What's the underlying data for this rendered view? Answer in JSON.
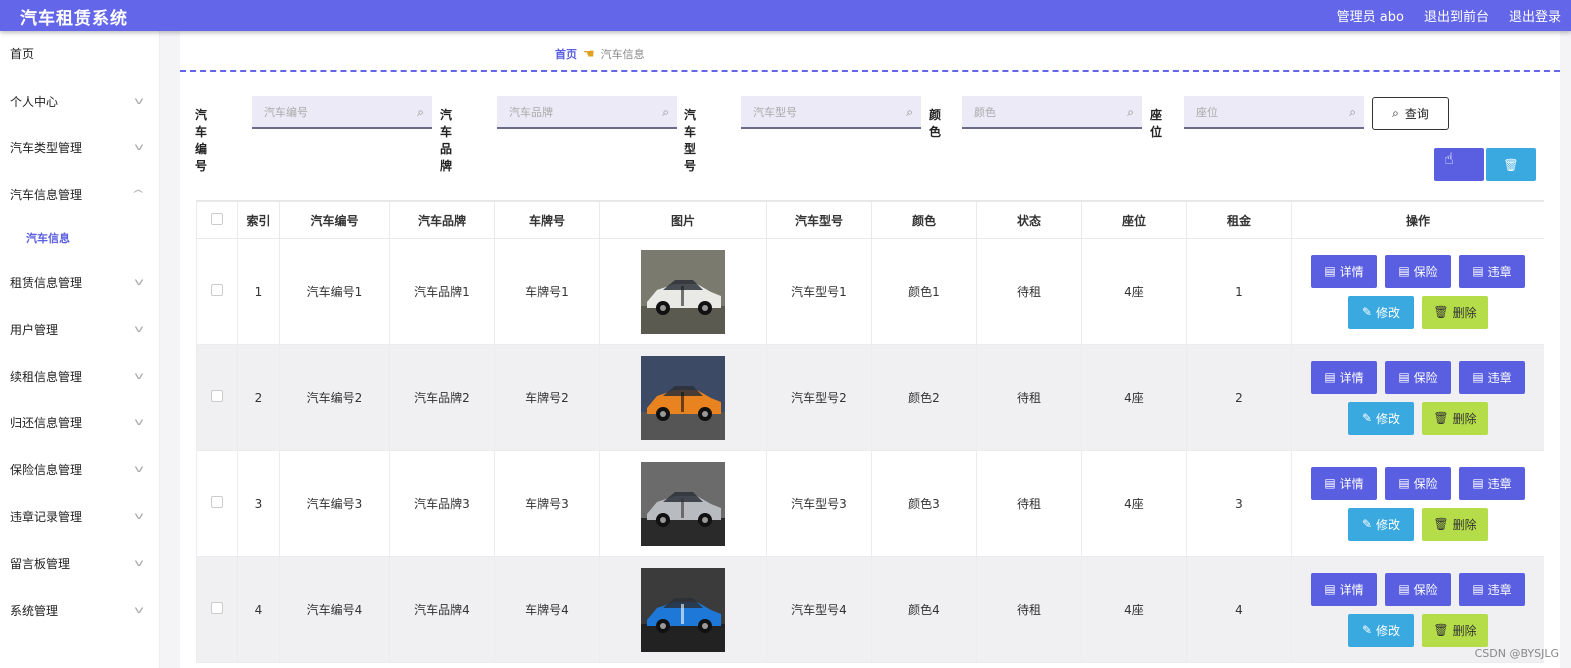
{
  "header": {
    "title": "汽车租赁系统",
    "user": "管理员 abo",
    "front_link": "退出到前台",
    "logout_link": "退出登录"
  },
  "sidebar": {
    "items": [
      {
        "label": "首页",
        "chev": false
      },
      {
        "label": "个人中心",
        "chev": true
      },
      {
        "label": "汽车类型管理",
        "chev": true
      },
      {
        "label": "汽车信息管理",
        "chev": true,
        "open": true
      },
      {
        "label": "汽车信息",
        "sub": true
      },
      {
        "label": "租赁信息管理",
        "chev": true
      },
      {
        "label": "用户管理",
        "chev": true
      },
      {
        "label": "续租信息管理",
        "chev": true
      },
      {
        "label": "归还信息管理",
        "chev": true
      },
      {
        "label": "保险信息管理",
        "chev": true
      },
      {
        "label": "违章记录管理",
        "chev": true
      },
      {
        "label": "留言板管理",
        "chev": true
      },
      {
        "label": "系统管理",
        "chev": true
      }
    ]
  },
  "breadcrumb": {
    "home": "首页",
    "current": "汽车信息"
  },
  "search": {
    "fields": [
      {
        "label": "汽车编号",
        "placeholder": "汽车编号"
      },
      {
        "label": "汽车品牌",
        "placeholder": "汽车品牌"
      },
      {
        "label": "汽车型号",
        "placeholder": "汽车型号"
      },
      {
        "label": "颜色",
        "placeholder": "颜色"
      },
      {
        "label": "座位",
        "placeholder": "座位"
      }
    ],
    "query_label": "查询"
  },
  "table": {
    "headers": [
      "索引",
      "汽车编号",
      "汽车品牌",
      "车牌号",
      "图片",
      "汽车型号",
      "颜色",
      "状态",
      "座位",
      "租金",
      "操作"
    ],
    "rows": [
      {
        "index": "1",
        "code": "汽车编号1",
        "brand": "汽车品牌1",
        "plate": "车牌号1",
        "model": "汽车型号1",
        "color": "颜色1",
        "status": "待租",
        "seats": "4座",
        "rent": "1"
      },
      {
        "index": "2",
        "code": "汽车编号2",
        "brand": "汽车品牌2",
        "plate": "车牌号2",
        "model": "汽车型号2",
        "color": "颜色2",
        "status": "待租",
        "seats": "4座",
        "rent": "2"
      },
      {
        "index": "3",
        "code": "汽车编号3",
        "brand": "汽车品牌3",
        "plate": "车牌号3",
        "model": "汽车型号3",
        "color": "颜色3",
        "status": "待租",
        "seats": "4座",
        "rent": "3"
      },
      {
        "index": "4",
        "code": "汽车编号4",
        "brand": "汽车品牌4",
        "plate": "车牌号4",
        "model": "汽车型号4",
        "color": "颜色4",
        "status": "待租",
        "seats": "4座",
        "rent": "4"
      }
    ],
    "ops": {
      "detail": "详情",
      "insurance": "保险",
      "violation": "违章",
      "edit": "修改",
      "delete": "删除"
    }
  },
  "watermark": "CSDN @BYSJLG",
  "colors": {
    "accent": "#6366e8",
    "button_blue": "#5a5fe2",
    "button_cyan": "#3aa9e0",
    "button_lime": "#b5dd4a"
  }
}
